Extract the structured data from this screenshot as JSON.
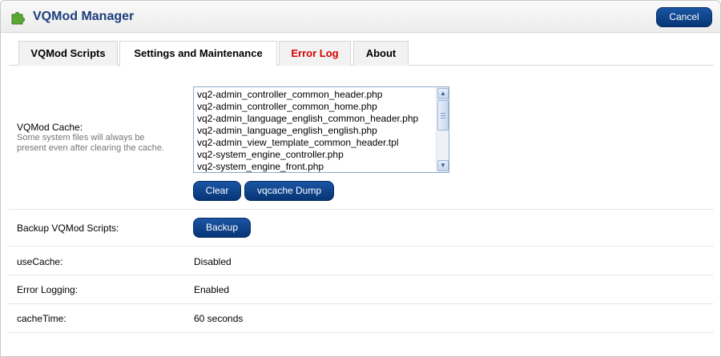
{
  "header": {
    "title": "VQMod Manager",
    "cancel_label": "Cancel",
    "logo_icon": "puzzle-piece-icon",
    "accent_color": "#0b3f85"
  },
  "tabs": [
    {
      "label": "VQMod Scripts",
      "active": false
    },
    {
      "label": "Settings and Maintenance",
      "active": true
    },
    {
      "label": "Error Log",
      "active": false,
      "color": "#d40000"
    },
    {
      "label": "About",
      "active": false
    }
  ],
  "cache": {
    "label": "VQMod Cache:",
    "help": "Some system files will always be present even after clearing the cache.",
    "files": [
      "vq2-admin_controller_common_header.php",
      "vq2-admin_controller_common_home.php",
      "vq2-admin_language_english_common_header.php",
      "vq2-admin_language_english_english.php",
      "vq2-admin_view_template_common_header.tpl",
      "vq2-system_engine_controller.php",
      "vq2-system_engine_front.php"
    ],
    "clear_label": "Clear",
    "dump_label": "vqcache Dump"
  },
  "backup": {
    "label": "Backup VQMod Scripts:",
    "button_label": "Backup"
  },
  "settings": [
    {
      "label": "useCache:",
      "value": "Disabled"
    },
    {
      "label": "Error Logging:",
      "value": "Enabled"
    },
    {
      "label": "cacheTime:",
      "value": "60 seconds"
    }
  ]
}
